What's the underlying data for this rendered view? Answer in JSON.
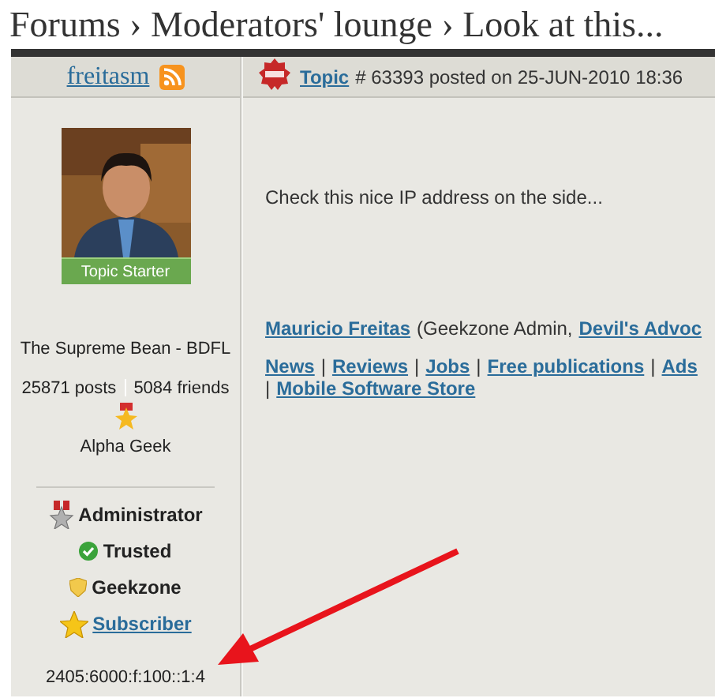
{
  "breadcrumb": [
    "Forums",
    "Moderators' lounge",
    "Look at this..."
  ],
  "breadcrumb_separator": "›",
  "author": {
    "name": "freitasm",
    "photo_label": "Topic Starter",
    "rank_title": "The Supreme Bean - BDFL",
    "posts": "25871 posts",
    "friends": "5084 friends",
    "level": "Alpha Geek",
    "roles": [
      {
        "kind": "admin",
        "label": "Administrator",
        "link": false
      },
      {
        "kind": "trusted",
        "label": "Trusted",
        "link": false
      },
      {
        "kind": "geekzone",
        "label": "Geekzone",
        "link": false
      },
      {
        "kind": "subscriber",
        "label": "Subscriber",
        "link": true
      }
    ],
    "ip": "2405:6000:f:100::1:4"
  },
  "post": {
    "type_link": "Topic",
    "meta": "# 63393 posted on 25-JUN-2010 18:36",
    "body": "Check this nice IP address on the side...",
    "signature": {
      "name_link": "Mauricio Freitas",
      "text": "(Geekzone Admin,",
      "role_link": "Devil's Advoc"
    },
    "nav_lines": [
      [
        "News",
        "Reviews",
        "Jobs",
        "Free publications",
        "Ads"
      ],
      [
        "Mobile Software Store"
      ]
    ],
    "nav_separator": "|"
  }
}
